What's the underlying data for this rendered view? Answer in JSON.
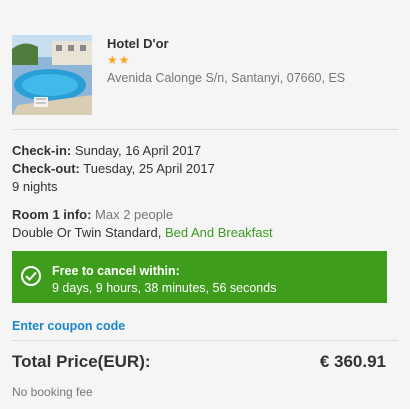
{
  "hotel": {
    "name": "Hotel D'or",
    "stars": "★★",
    "address": "Avenida Calonge S/n, Santanyi, 07660, ES"
  },
  "stay": {
    "checkin_label": "Check-in:",
    "checkin_value": " Sunday, 16 April 2017",
    "checkout_label": "Check-out:",
    "checkout_value": " Tuesday, 25 April 2017",
    "nights": "9 nights"
  },
  "room": {
    "label": "Room 1 info:",
    "occupancy": " Max 2 people",
    "type": "Double Or Twin Standard, ",
    "board": "Bed And Breakfast"
  },
  "cancellation": {
    "title": "Free to cancel within:",
    "timer": "9 days,  9 hours,  38 minutes,  56 seconds"
  },
  "coupon": {
    "label": "Enter coupon code"
  },
  "total": {
    "label": "Total Price(EUR):",
    "value": "€ 360.91",
    "fee_note": "No booking fee"
  },
  "colors": {
    "accent_green": "#3e9d1c",
    "link_blue": "#1b87c9",
    "star_orange": "#f5a623"
  }
}
